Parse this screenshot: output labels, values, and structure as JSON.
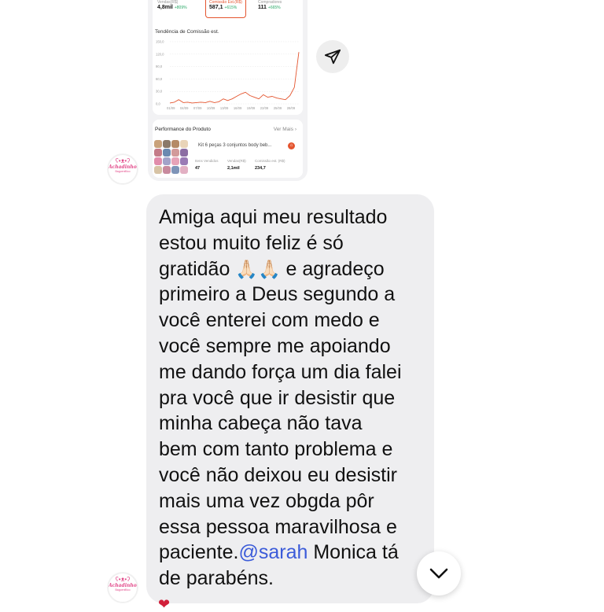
{
  "shared_post": {
    "metrics": [
      {
        "label": "Vendas(R$)",
        "value": "4,8mil",
        "change": "+809%"
      },
      {
        "label": "Comissão Est.(R$)",
        "value": "587,1",
        "change": "+615%"
      },
      {
        "label": "Compradores",
        "value": "111",
        "change": "+665%"
      }
    ],
    "trend_title": "Tendência de Comissão est.",
    "performance": {
      "title": "Performance do Produto",
      "more": "Ver Mais",
      "product_name": "Kit 6 peças 3 conjuntos body beb...",
      "stats": [
        {
          "label": "Itens Vendidos",
          "value": "47"
        },
        {
          "label": "Vendas(R$)",
          "value": "2,1mil"
        },
        {
          "label": "Comissão est. (R$)",
          "value": "234,7"
        }
      ]
    }
  },
  "chart_data": {
    "type": "line",
    "title": "Tendência de Comissão est.",
    "xlabel": "",
    "ylabel": "",
    "ylim": [
      0,
      150
    ],
    "yticks": [
      "150,0",
      "120,0",
      "90,0",
      "60,0",
      "30,0",
      "0,0"
    ],
    "xticks": [
      "01/09",
      "04/09",
      "07/09",
      "10/09",
      "13/09",
      "16/09",
      "19/09",
      "22/09",
      "25/09",
      "28/09"
    ],
    "x": [
      1,
      2,
      3,
      4,
      5,
      6,
      7,
      8,
      9,
      10,
      11,
      12,
      13,
      14,
      15,
      16,
      17,
      18,
      19,
      20,
      21,
      22,
      23,
      24,
      25,
      26,
      27,
      28,
      29,
      30
    ],
    "values": [
      2,
      4,
      10,
      3,
      4,
      2,
      3,
      4,
      3,
      6,
      3,
      5,
      12,
      8,
      12,
      18,
      24,
      28,
      20,
      16,
      12,
      22,
      16,
      18,
      14,
      12,
      10,
      20,
      40,
      125
    ],
    "grid": true,
    "line_color": "#e4552f"
  },
  "avatar": {
    "brand": "Achadinhos",
    "tagline": "Bagoenfilico"
  },
  "message": {
    "lines": [
      "Amiga aqui meu resultado",
      "estou muito feliz é só",
      "gratidão",
      "primeiro a Deus segundo a",
      "você enterei com medo e",
      "você sempre me apoiando",
      "me dando força um dia falei",
      "pra você que ir desistir que",
      "minha cabeça não tava",
      "bem com tanto problema e",
      "você não deixou eu desistir",
      "mais uma vez obgda pôr",
      "essa pessoa maravilhosa e"
    ],
    "emoji": "🙏🏻🙏🏻",
    "line3_after": " e agradeço",
    "line14_before": "paciente.",
    "mention": "@sarah",
    "line14_after": " Monica tá",
    "last_line": "de parabéns."
  },
  "reaction": "❤",
  "icons": {
    "share": "paper-plane-icon",
    "scroll": "chevron-down-icon",
    "avatar": "bear-icon"
  }
}
